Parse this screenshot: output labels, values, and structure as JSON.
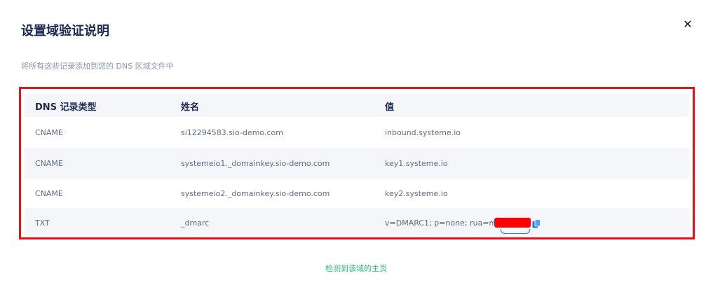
{
  "dialog": {
    "title": "设置域验证说明",
    "close_glyph": "✕",
    "subtitle": "将所有这些记录添加到您的 DNS 区域文件中"
  },
  "table": {
    "headers": [
      "DNS 记录类型",
      "姓名",
      "值"
    ],
    "rows": [
      {
        "type": "CNAME",
        "name": "si12294583.sio-demo.com",
        "value": "inbound.systeme.io"
      },
      {
        "type": "CNAME",
        "name": "systemeio1._domainkey.sio-demo.com",
        "value": "key1.systeme.io"
      },
      {
        "type": "CNAME",
        "name": "systemeio2._domainkey.sio-demo.com",
        "value": "key2.systeme.io"
      },
      {
        "type": "TXT",
        "name": "_dmarc",
        "value": "v=DMARC1; p=none; rua=mail"
      }
    ]
  },
  "icons": {
    "copy": "copy-icon",
    "close": "close-icon"
  },
  "colors": {
    "highlight_border": "#e3101d",
    "link": "#2ab37f",
    "title": "#1b2b55"
  },
  "footer": {
    "link_label": "检测到该域的主页"
  }
}
